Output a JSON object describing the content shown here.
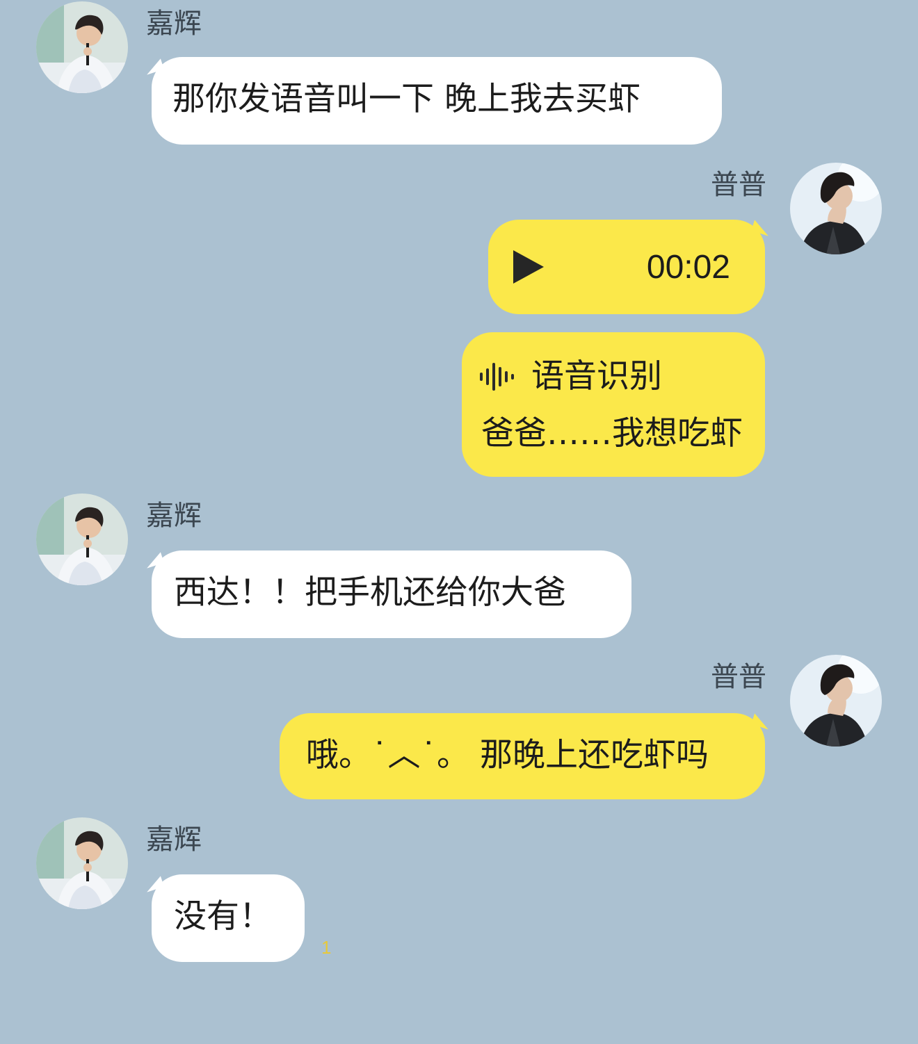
{
  "contacts": {
    "other": {
      "name": "嘉辉"
    },
    "self": {
      "name": "普普"
    }
  },
  "messages": {
    "m1": {
      "text": "那你发语音叫一下  晚上我去买虾"
    },
    "m2": {
      "duration": "00:02"
    },
    "m3": {
      "title": "语音识别",
      "text": "爸爸……我想吃虾"
    },
    "m4": {
      "text": "西达！！把手机还给你大爸"
    },
    "m5": {
      "text": "哦。˙︿˙。  那晚上还吃虾吗"
    },
    "m6": {
      "text": "没有！",
      "read_count": "1"
    }
  },
  "colors": {
    "background": "#abc1d1",
    "bubble_other": "#ffffff",
    "bubble_self": "#fbe84a"
  },
  "icons": {
    "play": "play-icon",
    "waveform": "waveform-icon"
  }
}
